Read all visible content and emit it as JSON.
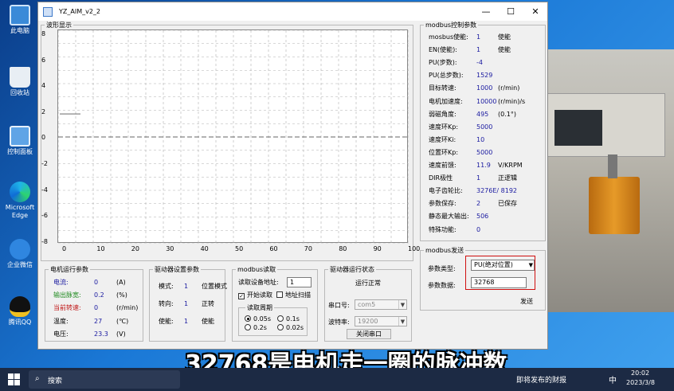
{
  "desktop_icons": [
    {
      "label": "此电脑"
    },
    {
      "label": "回收站"
    },
    {
      "label": "控制面板"
    },
    {
      "label": "Microsoft Edge"
    },
    {
      "label": "企业微信"
    },
    {
      "label": "腾讯QQ"
    }
  ],
  "window": {
    "title": "YZ_AIM_v2_2",
    "minimize": "—",
    "maximize": "☐",
    "close": "✕"
  },
  "waveform": {
    "group_label": "波形显示",
    "y_ticks": [
      "8",
      "6",
      "4",
      "2",
      "0",
      "-2",
      "-4",
      "-6",
      "-8"
    ],
    "x_ticks": [
      "0",
      "10",
      "20",
      "30",
      "40",
      "50",
      "60",
      "70",
      "80",
      "90",
      "100"
    ]
  },
  "modbus_params": {
    "group_label": "modbus控制参数",
    "rows": [
      {
        "name": "mosbus使能:",
        "value": "1",
        "unit": "使能"
      },
      {
        "name": "EN(使能):",
        "value": "1",
        "unit": "使能"
      },
      {
        "name": "PU(步数):",
        "value": "-4",
        "unit": ""
      },
      {
        "name": "PU(总步数):",
        "value": "1529",
        "unit": ""
      },
      {
        "name": "目标转速:",
        "value": "1000",
        "unit": "(r/min)"
      },
      {
        "name": "电机加速度:",
        "value": "10000",
        "unit": "(r/min)/s"
      },
      {
        "name": "弱磁角度:",
        "value": "495",
        "unit": "(0.1°)"
      },
      {
        "name": "速度环Kp:",
        "value": "5000",
        "unit": ""
      },
      {
        "name": "速度环Ki:",
        "value": "10",
        "unit": ""
      },
      {
        "name": "位置环Kp:",
        "value": "5000",
        "unit": ""
      },
      {
        "name": "速度前馈:",
        "value": "11.9",
        "unit": "V/KRPM"
      },
      {
        "name": "DIR极性",
        "value": "1",
        "unit": "正逻辑"
      },
      {
        "name": "电子齿轮比:",
        "value": "3276E/ 8192",
        "unit": ""
      },
      {
        "name": "参数保存:",
        "value": "2",
        "unit": "已保存"
      },
      {
        "name": "静态最大输出:",
        "value": "506",
        "unit": ""
      },
      {
        "name": "特殊功能:",
        "value": "0",
        "unit": ""
      }
    ]
  },
  "modbus_send": {
    "group_label": "modbus发送",
    "type_label": "参数类型:",
    "type_value": "PU(绝对位置)",
    "data_label": "参数数据:",
    "data_value": "32768",
    "send_button": "发送"
  },
  "motor_status": {
    "group_label": "电机运行参数",
    "rows": [
      {
        "name": "电流:",
        "value": "0",
        "unit": "(A)",
        "color": "#1a1aa0"
      },
      {
        "name": "输出脉宽:",
        "value": "0.2",
        "unit": "(%)",
        "color": "#1e8a1e"
      },
      {
        "name": "当前转速:",
        "value": "0",
        "unit": "(r/min)",
        "color": "#c01818"
      },
      {
        "name": "温度:",
        "value": "27",
        "unit": "(℃)",
        "color": "#000000"
      },
      {
        "name": "电压:",
        "value": "23.3",
        "unit": "(V)",
        "color": "#000000"
      }
    ]
  },
  "driver_settings": {
    "group_label": "驱动器设置参数",
    "rows": [
      {
        "name": "模式:",
        "value": "1",
        "unit": "位置模式"
      },
      {
        "name": "转向:",
        "value": "1",
        "unit": "正转"
      },
      {
        "name": "使能:",
        "value": "1",
        "unit": "使能"
      }
    ]
  },
  "modbus_read": {
    "group_label": "modbus读取",
    "addr_label": "读取设备地址:",
    "addr_value": "1",
    "start_read": "开始读取",
    "start_checked": "✓",
    "addr_scan": "地址扫描",
    "period_label": "读取周期",
    "periods": [
      "0.05s",
      "0.1s",
      "0.2s",
      "0.02s"
    ]
  },
  "driver_status": {
    "group_label": "驱动器运行状态",
    "status": "运行正常",
    "port_label": "串口号:",
    "port_value": "com5",
    "baud_label": "波特率:",
    "baud_value": "19200",
    "close_port": "关闭串口"
  },
  "subtitle": "32768是电机走一圈的脉冲数",
  "taskbar": {
    "search": "搜索",
    "news": "即将发布的财报",
    "ime": "中",
    "time": "20:02",
    "date": "2023/3/8"
  },
  "colors": {
    "accent_red": "#d01010",
    "value_blue": "#1a1aa0"
  }
}
